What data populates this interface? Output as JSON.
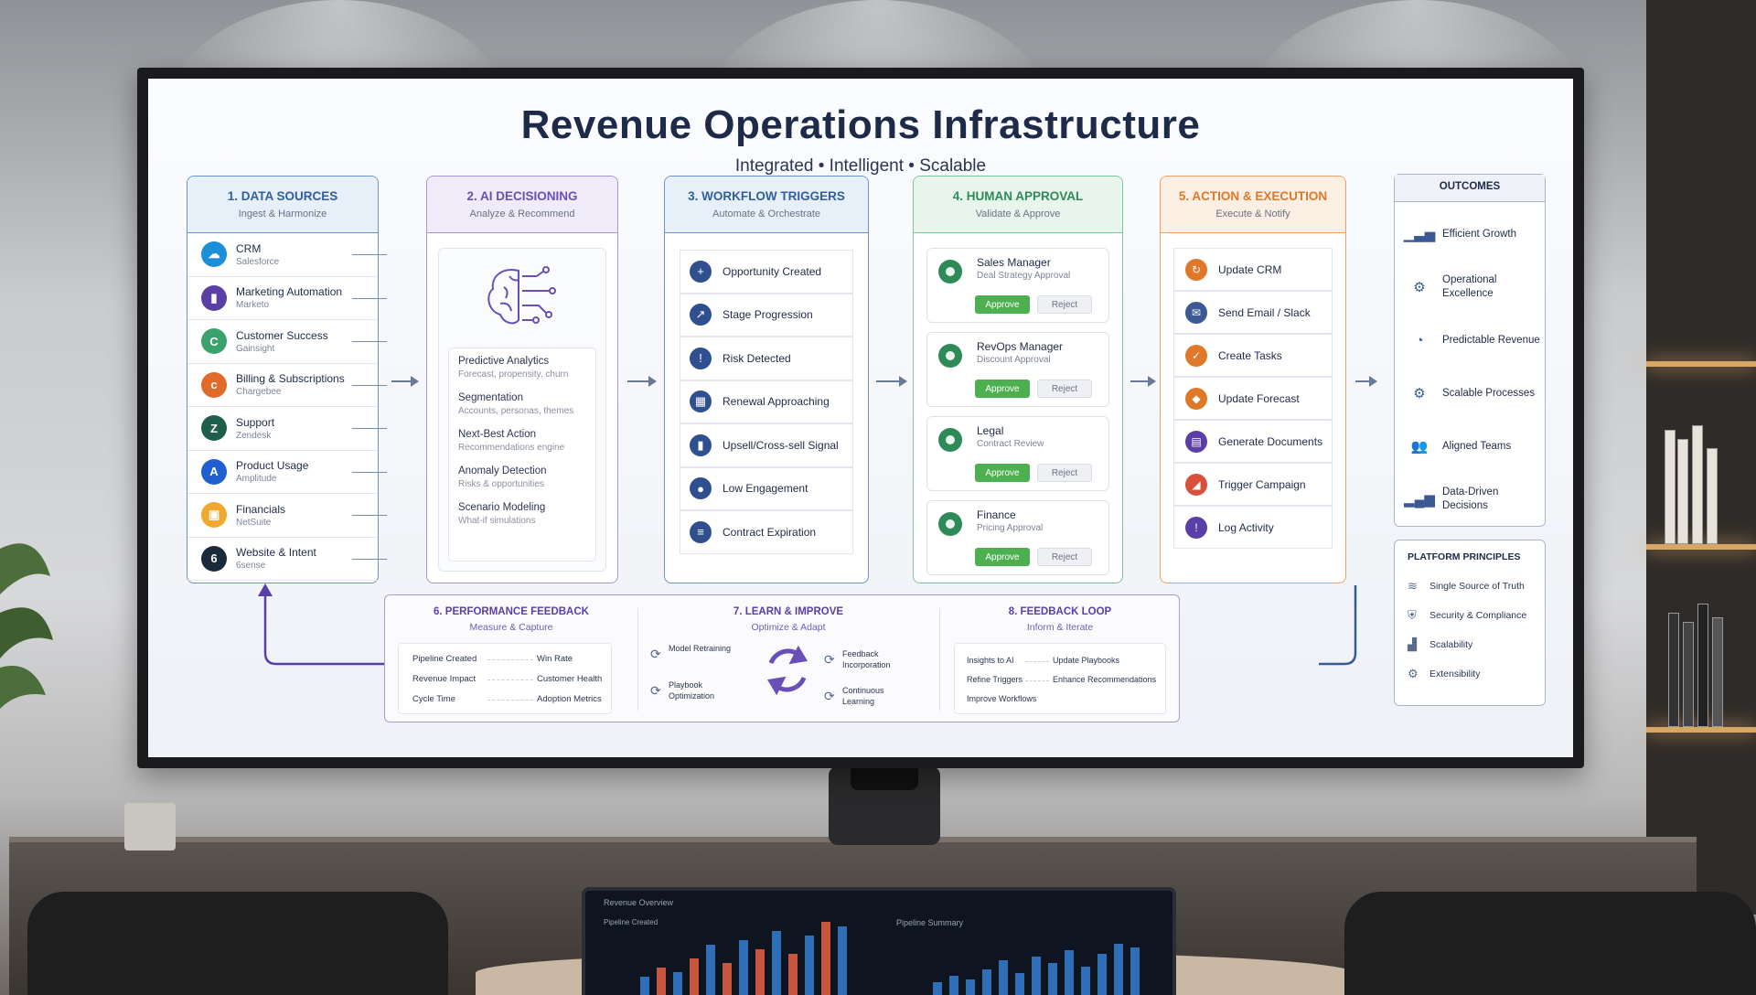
{
  "header": {
    "title": "Revenue Operations Infrastructure",
    "subtitle": "Integrated • Intelligent • Scalable"
  },
  "columns": [
    {
      "title": "1. DATA SOURCES",
      "subtitle": "Ingest & Harmonize",
      "color": "#2f5f9e"
    },
    {
      "title": "2. AI DECISIONING",
      "subtitle": "Analyze & Recommend",
      "color": "#6a4fb8"
    },
    {
      "title": "3. WORKFLOW TRIGGERS",
      "subtitle": "Automate & Orchestrate",
      "color": "#2f5f9e"
    },
    {
      "title": "4. HUMAN APPROVAL",
      "subtitle": "Validate & Approve",
      "color": "#2e8b57"
    },
    {
      "title": "5. ACTION & EXECUTION",
      "subtitle": "Execute & Notify",
      "color": "#e0782a"
    }
  ],
  "data_sources": [
    {
      "name": "CRM",
      "sub": "Salesforce",
      "color": "#1b8fd8",
      "glyph": "☁"
    },
    {
      "name": "Marketing Automation",
      "sub": "Marketo",
      "color": "#5b3fa6",
      "glyph": "▮"
    },
    {
      "name": "Customer Success",
      "sub": "Gainsight",
      "color": "#3aa36b",
      "glyph": "C"
    },
    {
      "name": "Billing & Subscriptions",
      "sub": "Chargebee",
      "color": "#e06a2a",
      "glyph": "c"
    },
    {
      "name": "Support",
      "sub": "Zendesk",
      "color": "#1f5e4a",
      "glyph": "Z"
    },
    {
      "name": "Product Usage",
      "sub": "Amplitude",
      "color": "#1f5fcf",
      "glyph": "A"
    },
    {
      "name": "Financials",
      "sub": "NetSuite",
      "color": "#f0a830",
      "glyph": "▣"
    },
    {
      "name": "Website & Intent",
      "sub": "6sense",
      "color": "#1a2a3a",
      "glyph": "6"
    }
  ],
  "ai_items": [
    {
      "name": "Predictive Analytics",
      "sub": "Forecast, propensity, churn"
    },
    {
      "name": "Segmentation",
      "sub": "Accounts, personas, themes"
    },
    {
      "name": "Next-Best Action",
      "sub": "Recommendations engine"
    },
    {
      "name": "Anomaly Detection",
      "sub": "Risks & opportunities"
    },
    {
      "name": "Scenario Modeling",
      "sub": "What-if simulations"
    }
  ],
  "workflow": [
    {
      "name": "Opportunity Created",
      "glyph": "+"
    },
    {
      "name": "Stage Progression",
      "glyph": "↗"
    },
    {
      "name": "Risk Detected",
      "glyph": "!"
    },
    {
      "name": "Renewal Approaching",
      "glyph": "▦"
    },
    {
      "name": "Upsell/Cross-sell Signal",
      "glyph": "▮"
    },
    {
      "name": "Low Engagement",
      "glyph": "●"
    },
    {
      "name": "Contract Expiration",
      "glyph": "≡"
    }
  ],
  "approvals": [
    {
      "name": "Sales Manager",
      "sub": "Deal Strategy Approval",
      "approve": "Approve",
      "reject": "Reject"
    },
    {
      "name": "RevOps Manager",
      "sub": "Discount Approval",
      "approve": "Approve",
      "reject": "Reject"
    },
    {
      "name": "Legal",
      "sub": "Contract Review",
      "approve": "Approve",
      "reject": "Reject"
    },
    {
      "name": "Finance",
      "sub": "Pricing Approval",
      "approve": "Approve",
      "reject": "Reject"
    }
  ],
  "actions": [
    {
      "name": "Update CRM",
      "color": "#e0782a",
      "glyph": "↻"
    },
    {
      "name": "Send Email / Slack",
      "color": "#3b5a93",
      "glyph": "✉"
    },
    {
      "name": "Create Tasks",
      "color": "#e0782a",
      "glyph": "✓"
    },
    {
      "name": "Update Forecast",
      "color": "#e0782a",
      "glyph": "◆"
    },
    {
      "name": "Generate Documents",
      "color": "#5b3fa6",
      "glyph": "▤"
    },
    {
      "name": "Trigger Campaign",
      "color": "#d9503a",
      "glyph": "◢"
    },
    {
      "name": "Log Activity",
      "color": "#5b3fa6",
      "glyph": "!"
    }
  ],
  "outcomes": {
    "title": "OUTCOMES",
    "items": [
      {
        "name": "Efficient Growth",
        "glyph": "▁▃▅"
      },
      {
        "name": "Operational Excellence",
        "glyph": "⚙"
      },
      {
        "name": "Predictable Revenue",
        "glyph": "◔"
      },
      {
        "name": "Scalable Processes",
        "glyph": "⚙"
      },
      {
        "name": "Aligned Teams",
        "glyph": "👥"
      },
      {
        "name": "Data-Driven Decisions",
        "glyph": "▂▄▆"
      }
    ]
  },
  "principles": {
    "title": "PLATFORM PRINCIPLES",
    "items": [
      {
        "name": "Single Source of Truth",
        "glyph": "≋"
      },
      {
        "name": "Security & Compliance",
        "glyph": "⛨"
      },
      {
        "name": "Scalability",
        "glyph": "▟"
      },
      {
        "name": "Extensibility",
        "glyph": "⚙"
      }
    ]
  },
  "bottom": {
    "perf": {
      "title": "6. PERFORMANCE FEEDBACK",
      "subtitle": "Measure & Capture",
      "left": [
        "Pipeline Created",
        "Revenue Impact",
        "Cycle Time"
      ],
      "right": [
        "Win Rate",
        "Customer Health",
        "Adoption Metrics"
      ]
    },
    "learn": {
      "title": "7. LEARN & IMPROVE",
      "subtitle": "Optimize & Adapt",
      "items": [
        "Model Retraining",
        "Playbook Optimization",
        "Feedback Incorporation",
        "Continuous Learning"
      ]
    },
    "loop": {
      "title": "8. FEEDBACK LOOP",
      "subtitle": "Inform & Iterate",
      "left": [
        "Insights to AI",
        "Refine Triggers",
        "Improve Workflows"
      ],
      "right": [
        "Update Playbooks",
        "Enhance Recommendations"
      ]
    }
  },
  "laptop": {
    "left_title": "Revenue Overview",
    "left_sub": "Pipeline Created",
    "right_title": "Pipeline Summary"
  }
}
